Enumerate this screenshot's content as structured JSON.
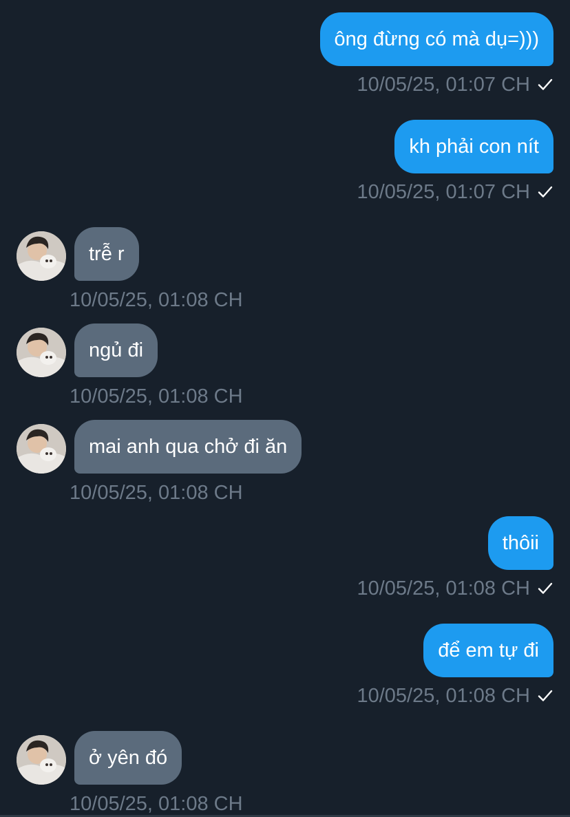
{
  "conversation": {
    "messages": [
      {
        "direction": "outgoing",
        "text": "ông đừng có mà dụ=)))",
        "timestamp": "10/05/25, 01:07 CH",
        "status": "sent-check-icon"
      },
      {
        "direction": "outgoing",
        "text": "kh phải con nít",
        "timestamp": "10/05/25, 01:07 CH",
        "status": "sent-check-icon"
      },
      {
        "direction": "incoming",
        "text": "trễ r",
        "timestamp": "10/05/25, 01:08 CH",
        "avatar": "contact-avatar"
      },
      {
        "direction": "incoming",
        "text": "ngủ đi",
        "timestamp": "10/05/25, 01:08 CH",
        "avatar": "contact-avatar"
      },
      {
        "direction": "incoming",
        "text": "mai anh qua chở đi ăn",
        "timestamp": "10/05/25, 01:08 CH",
        "avatar": "contact-avatar"
      },
      {
        "direction": "outgoing",
        "text": "thôii",
        "timestamp": "10/05/25, 01:08 CH",
        "status": "sent-check-icon"
      },
      {
        "direction": "outgoing",
        "text": "để em tự đi",
        "timestamp": "10/05/25, 01:08 CH",
        "status": "sent-check-icon"
      },
      {
        "direction": "incoming",
        "text": "ở yên đó",
        "timestamp": "10/05/25, 01:08 CH",
        "avatar": "contact-avatar"
      }
    ]
  },
  "colors": {
    "background": "#17202b",
    "outgoing_bubble": "#1d9bf0",
    "incoming_bubble": "#5b6b7c",
    "timestamp": "#6d7a89",
    "bubble_text": "#ffffff"
  }
}
